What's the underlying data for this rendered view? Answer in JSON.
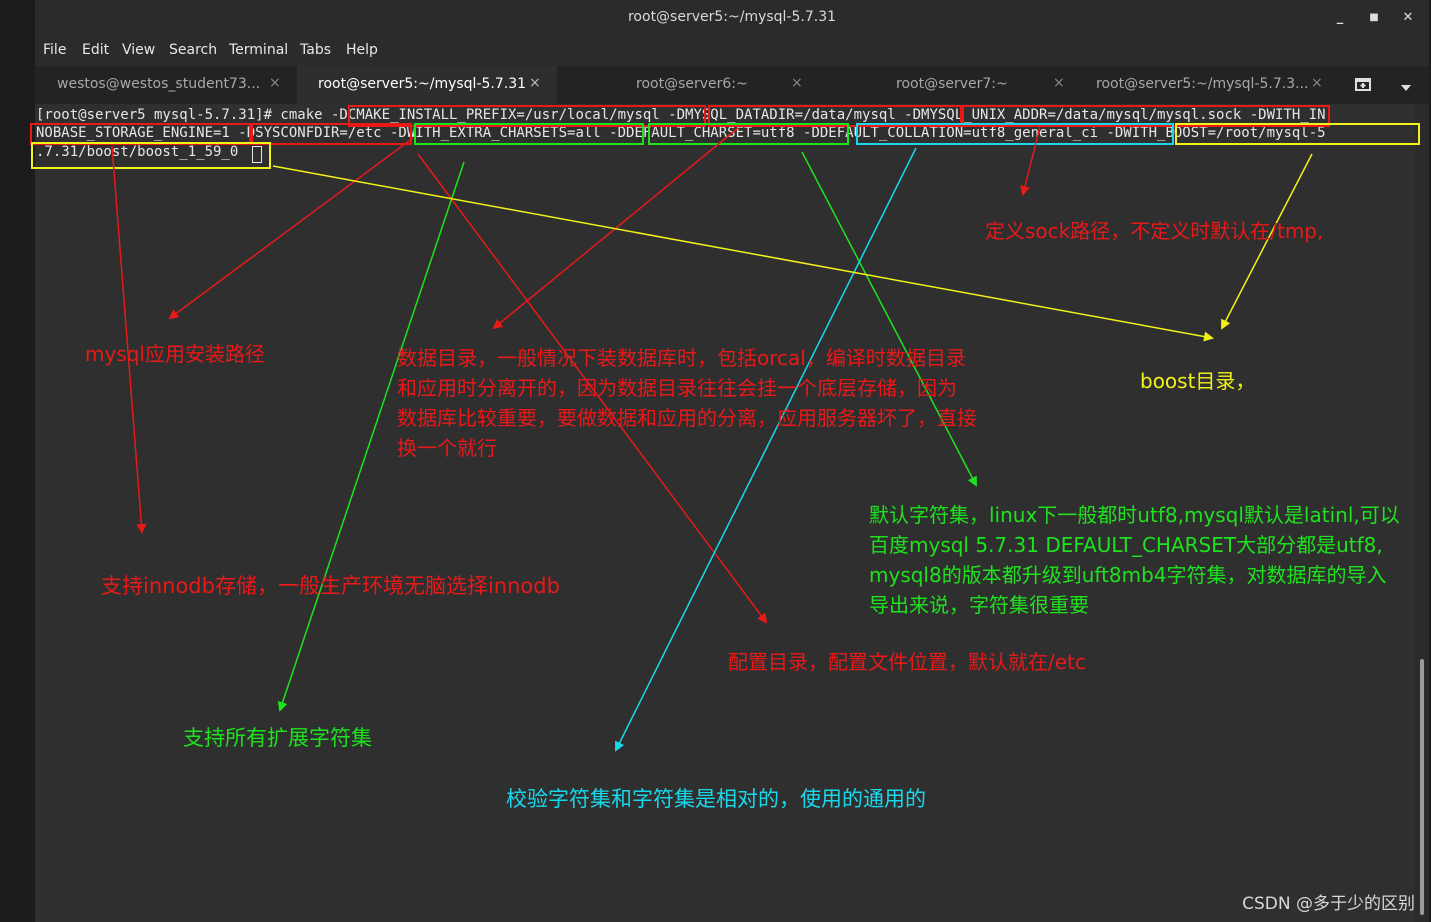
{
  "window": {
    "title": "root@server5:~/mysql-5.7.31",
    "minimize_glyph": "_",
    "maximize_glyph": "■",
    "close_glyph": "✕"
  },
  "menu": [
    "File",
    "Edit",
    "View",
    "Search",
    "Terminal",
    "Tabs",
    "Help"
  ],
  "tabs": [
    {
      "label": "westos@westos_student73...",
      "active": false
    },
    {
      "label": "root@server5:~/mysql-5.7.31",
      "active": true
    },
    {
      "label": "root@server6:~",
      "active": false
    },
    {
      "label": "root@server7:~",
      "active": false
    },
    {
      "label": "root@server5:~/mysql-5.7.3...",
      "active": false
    }
  ],
  "tab_close_glyph": "×",
  "terminal": {
    "lines": [
      "[root@server5 mysql-5.7.31]# cmake -DCMAKE_INSTALL_PREFIX=/usr/local/mysql -DMYSQL_DATADIR=/data/mysql -DMYSQL_UNIX_ADDR=/data/mysql/mysql.sock -DWITH_IN",
      "NOBASE_STORAGE_ENGINE=1 -DSYSCONFDIR=/etc -DWITH_EXTRA_CHARSETS=all -DDEFAULT_CHARSET=utf8 -DDEFAULT_COLLATION=utf8_general_ci -DWITH_BOOST=/root/mysql-5",
      ".7.31/boost/boost_1_59_0"
    ]
  },
  "annotations": {
    "sock": "定义sock路径，不定义时默认在/tmp,",
    "prefix": "mysql应用安装路径",
    "datadir": [
      "数据目录，一般情况下装数据库时，包括orcal，编译时数据目录",
      "和应用时分离开的，因为数据目录往往会挂一个底层存储，因为",
      "数据库比较重要，要做数据和应用的分离，应用服务器坏了，直接",
      "换一个就行"
    ],
    "boost": "boost目录，",
    "charset": [
      "默认字符集，linux下一般都时utf8,mysql默认是latinl,可以",
      "百度mysql 5.7.31 DEFAULT_CHARSET大部分都是utf8,",
      "mysql8的版本都升级到uft8mb4字符集，对数据库的导入",
      "导出来说，字符集很重要"
    ],
    "innodb": "支持innodb存储，一般生产环境无脑选择innodb",
    "sysconfdir": "配置目录，配置文件位置，默认就在/etc",
    "extra_charsets": "支持所有扩展字符集",
    "collation": "校验字符集和字符集是相对的，使用的通用的"
  },
  "colors": {
    "red": "#e81919",
    "green": "#1ee21e",
    "yellow": "#f2f21a",
    "cyan": "#18d9ec"
  },
  "watermark": "CSDN @多于少的区别"
}
